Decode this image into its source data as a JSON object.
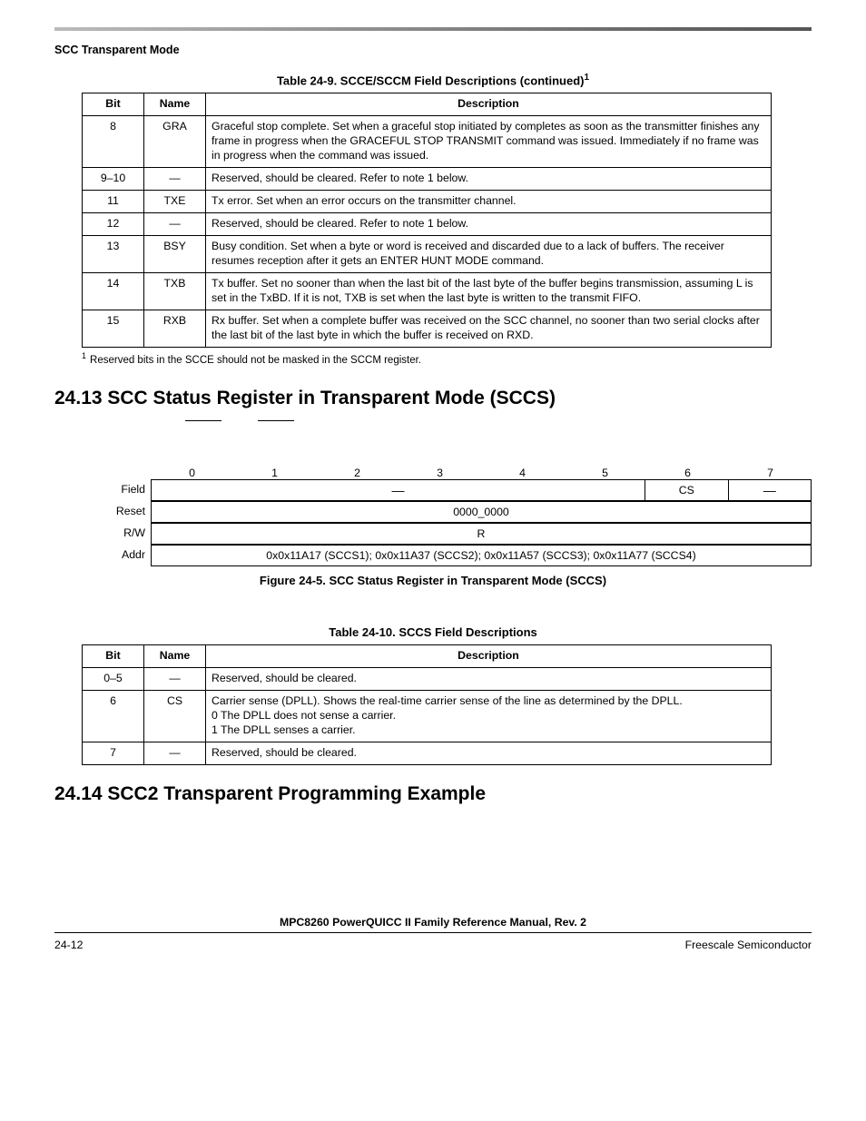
{
  "header": {
    "section_label": "SCC Transparent Mode"
  },
  "table1": {
    "caption_prefix": "Table 24-9. SCCE/SCCM Field Descriptions (continued)",
    "caption_sup": "1",
    "columns": {
      "bit": "Bit",
      "name": "Name",
      "desc": "Description"
    },
    "rows": [
      {
        "bit": "8",
        "name": "GRA",
        "desc": "Graceful stop complete. Set when a graceful stop initiated by completes as soon as the transmitter finishes any frame in progress when the GRACEFUL STOP TRANSMIT command was issued. Immediately if no frame was in progress when the command was issued."
      },
      {
        "bit": "9–10",
        "name": "—",
        "desc": "Reserved, should be cleared. Refer to note 1 below."
      },
      {
        "bit": "11",
        "name": "TXE",
        "desc": "Tx error. Set when an error occurs on the transmitter channel."
      },
      {
        "bit": "12",
        "name": "—",
        "desc": "Reserved, should be cleared. Refer to note 1 below."
      },
      {
        "bit": "13",
        "name": "BSY",
        "desc": "Busy condition. Set when a byte or word is received and discarded due to a lack of buffers. The receiver resumes reception after it gets an ENTER HUNT MODE command."
      },
      {
        "bit": "14",
        "name": "TXB",
        "desc": "Tx buffer. Set no sooner than when the last bit of the last byte of the buffer begins transmission, assuming L is set in the TxBD. If it is not, TXB is set when the last byte is written to the transmit FIFO."
      },
      {
        "bit": "15",
        "name": "RXB",
        "desc": "Rx buffer. Set when a complete buffer was received on the SCC channel, no sooner than two serial clocks after the last bit of the last byte in which the buffer is received on RXD."
      }
    ],
    "footnote_sup": "1",
    "footnote": "Reserved bits in the SCCE should not be masked in the SCCM register."
  },
  "section_24_13": {
    "heading": "24.13  SCC Status Register in Transparent Mode (SCCS)"
  },
  "register_fig": {
    "bit_labels": [
      "0",
      "1",
      "2",
      "3",
      "4",
      "5",
      "6",
      "7"
    ],
    "rows_left": {
      "field": "Field",
      "reset": "Reset",
      "rw": "R/W",
      "addr": "Addr"
    },
    "field_dash": "—",
    "field_cs": "CS",
    "field_dash2": "—",
    "reset_val": "0000_0000",
    "rw_val": "R",
    "addr_val": "0x0x11A17 (SCCS1); 0x0x11A37 (SCCS2); 0x0x11A57 (SCCS3); 0x0x11A77 (SCCS4)",
    "caption": "Figure 24-5. SCC Status Register in Transparent Mode (SCCS)"
  },
  "table2": {
    "caption": "Table 24-10. SCCS Field Descriptions",
    "columns": {
      "bit": "Bit",
      "name": "Name",
      "desc": "Description"
    },
    "rows": [
      {
        "bit": "0–5",
        "name": "—",
        "desc": "Reserved, should be cleared."
      },
      {
        "bit": "6",
        "name": "CS",
        "desc": "Carrier sense (DPLL). Shows the real-time carrier sense of the line as determined by the DPLL.\n0  The DPLL does not sense a carrier.\n1  The DPLL senses a carrier."
      },
      {
        "bit": "7",
        "name": "—",
        "desc": "Reserved, should be cleared."
      }
    ]
  },
  "section_24_14": {
    "heading": "24.14  SCC2 Transparent Programming Example"
  },
  "footer": {
    "manual": "MPC8260 PowerQUICC II Family Reference Manual, Rev. 2",
    "page": "24-12",
    "company": "Freescale Semiconductor"
  }
}
